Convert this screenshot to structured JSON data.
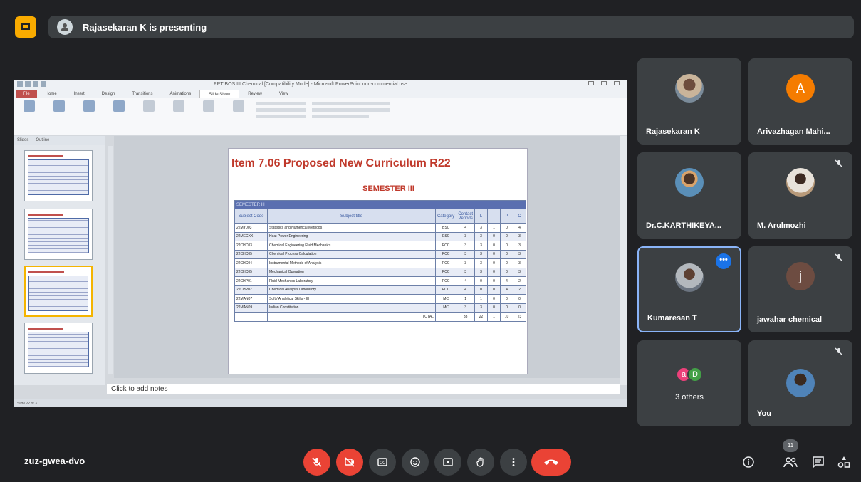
{
  "top": {
    "presenting_text": "Rajasekaran K is presenting"
  },
  "powerpoint": {
    "window_title": "PPT BOS III Chemical [Compatibility Mode] - Microsoft PowerPoint non-commercial use",
    "tabs": [
      "File",
      "Home",
      "Insert",
      "Design",
      "Transitions",
      "Animations",
      "Slide Show",
      "Review",
      "View"
    ],
    "active_tab": "Slide Show",
    "thumbnail_panel_tabs": [
      "Slides",
      "Outline"
    ],
    "notes_placeholder": "Click to add notes",
    "status_text": "Slide 22 of 31",
    "slide": {
      "title": "Item 7.06 Proposed New Curriculum R22",
      "subtitle": "SEMESTER III",
      "band": "SEMESTER III",
      "headers": [
        "Subject Code",
        "Subject title",
        "Category",
        "Contact Periods",
        "L",
        "T",
        "P",
        "C"
      ],
      "rows": [
        [
          "22MY003",
          "Statistics and Numerical Methods",
          "BSC",
          "4",
          "3",
          "1",
          "0",
          "4"
        ],
        [
          "22MECXX",
          "Heat Power Engineering",
          "ESC",
          "3",
          "3",
          "0",
          "0",
          "3"
        ],
        [
          "22CHC03",
          "Chemical Engineering Fluid Mechanics",
          "PCC",
          "3",
          "3",
          "0",
          "0",
          "3"
        ],
        [
          "22CHC05",
          "Chemical Process Calculation",
          "PCC",
          "3",
          "3",
          "0",
          "0",
          "3"
        ],
        [
          "22CHC04",
          "Instrumental Methods of Analysis",
          "PCC",
          "3",
          "3",
          "0",
          "0",
          "3"
        ],
        [
          "22CHC05",
          "Mechanical Operation",
          "PCC",
          "3",
          "3",
          "0",
          "0",
          "3"
        ],
        [
          "22CHP01",
          "Fluid Mechanics Laboratory",
          "PCC",
          "4",
          "0",
          "0",
          "4",
          "2"
        ],
        [
          "22CHP02",
          "Chemical Analysis Laboratory",
          "PCC",
          "4",
          "0",
          "0",
          "4",
          "2"
        ],
        [
          "22MAN07",
          "Soft / Analytical Skills - III",
          "MC",
          "1",
          "1",
          "0",
          "0",
          "0"
        ],
        [
          "22MAN09",
          "Indian Constitution",
          "MC",
          "3",
          "3",
          "0",
          "0",
          "0"
        ]
      ],
      "total_label": "TOTAL",
      "totals": [
        "33",
        "22",
        "1",
        "10",
        "23"
      ]
    }
  },
  "participants": [
    {
      "name": "Rajasekaran K",
      "avatar": "photo",
      "muted": false
    },
    {
      "name": "Arivazhagan Mahi...",
      "avatar": "A",
      "avatar_color": "#f57c00",
      "muted": false
    },
    {
      "name": "Dr.C.KARTHIKEYA...",
      "avatar": "photo",
      "muted": false
    },
    {
      "name": "M. Arulmozhi",
      "avatar": "photo",
      "muted": true
    },
    {
      "name": "Kumaresan T",
      "avatar": "photo",
      "muted": false,
      "speaking": true
    },
    {
      "name": "jawahar chemical",
      "avatar": "j",
      "avatar_color": "#6d4c41",
      "muted": true
    },
    {
      "name": "You",
      "avatar": "photo",
      "muted": true
    }
  ],
  "others": {
    "label": "3 others",
    "avatars": [
      {
        "letter": "a",
        "color": "#ec407a"
      },
      {
        "letter": "D",
        "color": "#43a047"
      }
    ]
  },
  "bottom": {
    "meeting_code": "zuz-gwea-dvo",
    "participant_count": "11"
  },
  "icons": [
    "raise-hand-icon",
    "mic-off-icon",
    "camera-off-icon",
    "captions-icon",
    "emoji-icon",
    "present-icon",
    "hand-icon",
    "more-options-icon",
    "end-call-icon",
    "info-icon",
    "people-icon",
    "chat-icon",
    "activities-icon"
  ]
}
